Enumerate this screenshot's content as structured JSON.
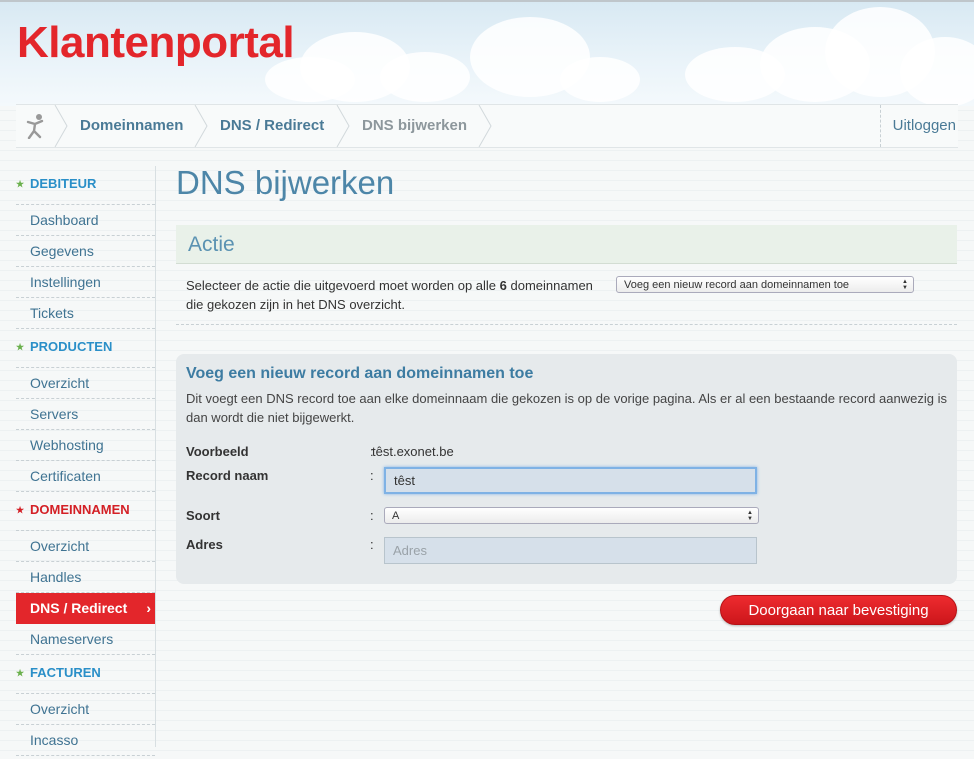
{
  "header": {
    "logo": "Klantenportal"
  },
  "breadcrumb": {
    "items": [
      "Domeinnamen",
      "DNS / Redirect",
      "DNS bijwerken"
    ],
    "logout": "Uitloggen"
  },
  "sidebar": {
    "sections": [
      {
        "title": "DEBITEUR",
        "items": [
          "Dashboard",
          "Gegevens",
          "Instellingen",
          "Tickets"
        ]
      },
      {
        "title": "PRODUCTEN",
        "items": [
          "Overzicht",
          "Servers",
          "Webhosting",
          "Certificaten"
        ]
      },
      {
        "title": "DOMEINNAMEN",
        "items": [
          "Overzicht",
          "Handles",
          "DNS / Redirect",
          "Nameservers"
        ]
      },
      {
        "title": "FACTUREN",
        "items": [
          "Overzicht",
          "Incasso"
        ]
      }
    ],
    "active_item": "DNS / Redirect",
    "active_arrow": "›"
  },
  "main": {
    "title": "DNS bijwerken",
    "action_heading": "Actie",
    "action_text_1": "Selecteer de actie die uitgevoerd moet worden op alle",
    "action_count": "6",
    "action_text_2": "domeinnamen die gekozen zijn in het DNS overzicht.",
    "action_select": "Voeg een nieuw record aan domeinnamen toe",
    "panel": {
      "title": "Voeg een nieuw record aan domeinnamen toe",
      "description": "Dit voegt een DNS record toe aan elke domeinnaam die gekozen is op de vorige pagina. Als er al een bestaande record aanwezig is dan wordt die niet bijgewerkt.",
      "example_label": "Voorbeeld",
      "example_value": "têst.exonet.be",
      "record_label": "Record naam",
      "record_value": "têst",
      "type_label": "Soort",
      "type_value": "A",
      "address_label": "Adres",
      "address_placeholder": "Adres",
      "colon": ":"
    },
    "submit": "Doorgaan naar bevestiging"
  }
}
